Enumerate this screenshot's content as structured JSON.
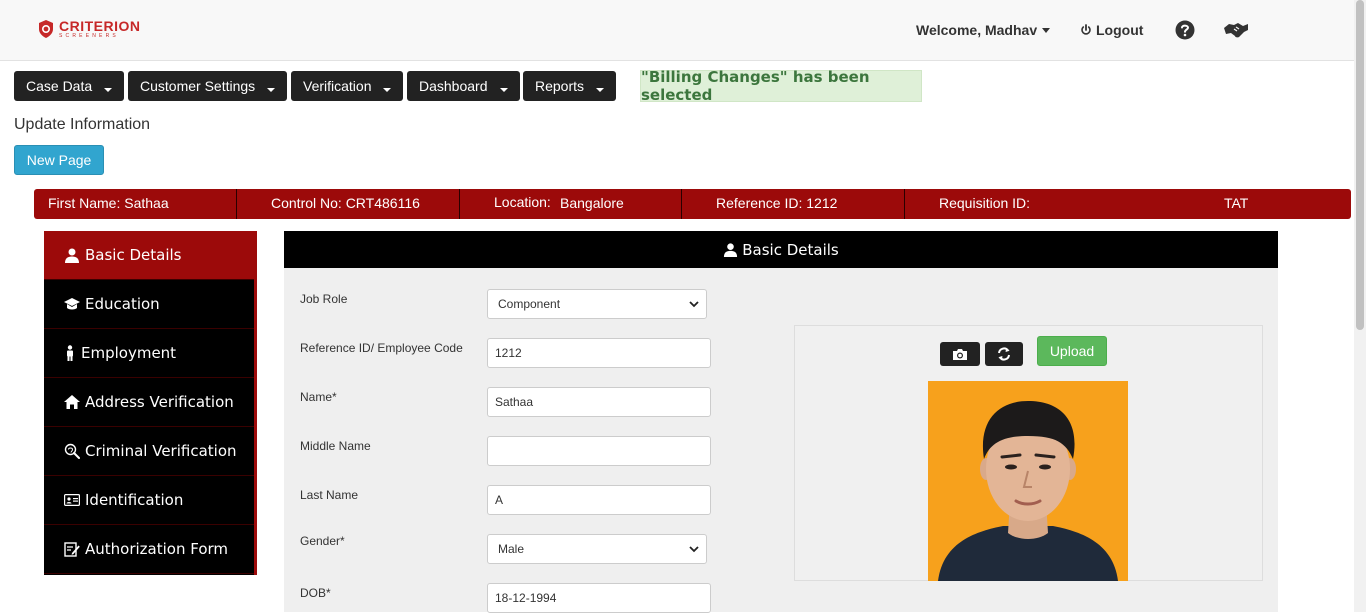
{
  "header": {
    "logo_main": "CRITERION",
    "logo_sub": "SCREENERS",
    "welcome": "Welcome, Madhav",
    "logout": "Logout"
  },
  "menu": [
    {
      "label": "Case Data"
    },
    {
      "label": "Customer Settings"
    },
    {
      "label": "Verification"
    },
    {
      "label": "Dashboard"
    },
    {
      "label": "Reports"
    }
  ],
  "notice": "\"Billing Changes\" has been selected",
  "page_title": "Update Information",
  "new_page_button": "New Page",
  "infobar": {
    "first_name": "First Name: Sathaa",
    "control_no": "Control No: CRT486116",
    "location_label": "Location:",
    "location_value": "Bangalore",
    "reference_id": "Reference ID: 1212",
    "requisition_id": "Requisition ID:",
    "tat": "TAT"
  },
  "sidenav": [
    {
      "label": "Basic Details",
      "icon": "user-icon",
      "active": true
    },
    {
      "label": "Education",
      "icon": "graduation-cap-icon"
    },
    {
      "label": "Employment",
      "icon": "person-icon"
    },
    {
      "label": "Address Verification",
      "icon": "home-icon"
    },
    {
      "label": "Criminal Verification",
      "icon": "fingerprint-icon"
    },
    {
      "label": "Identification",
      "icon": "id-card-icon"
    },
    {
      "label": "Authorization Form",
      "icon": "edit-icon"
    }
  ],
  "panel": {
    "title": "Basic Details",
    "fields": {
      "job_role_label": "Job Role",
      "job_role_value": "Component",
      "reference_label": "Reference ID/ Employee Code",
      "reference_value": "1212",
      "name_label": "Name*",
      "name_value": "Sathaa",
      "middle_label": "Middle Name",
      "middle_value": "",
      "last_label": "Last Name",
      "last_value": "A",
      "gender_label": "Gender*",
      "gender_value": "Male",
      "dob_label": "DOB*",
      "dob_value": "18-12-1994"
    },
    "upload_button": "Upload"
  },
  "colors": {
    "brand_red": "#9c0a0a",
    "notice_green": "#3c763d",
    "upload_green": "#5cb85c",
    "new_page_blue": "#31a5cf"
  }
}
